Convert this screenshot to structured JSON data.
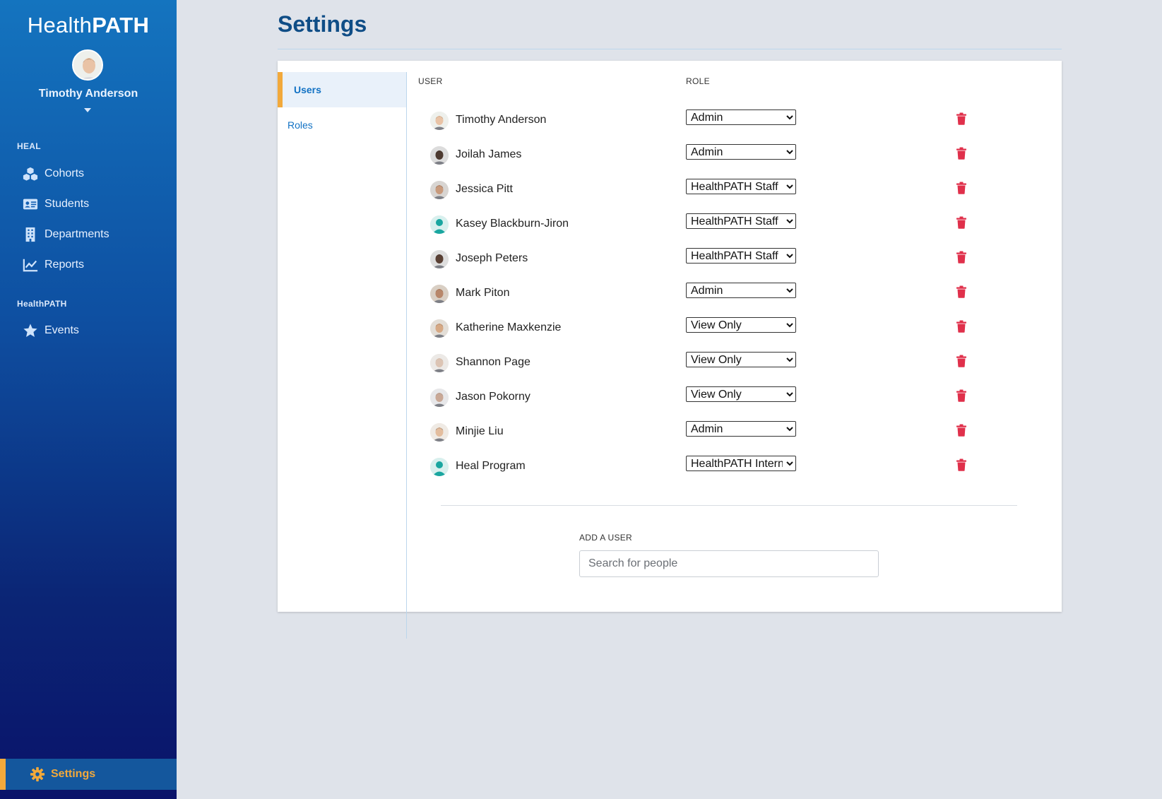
{
  "app": {
    "logo_light": "Health",
    "logo_bold": "PATH"
  },
  "profile": {
    "name": "Timothy Anderson"
  },
  "sidebar": {
    "sections": [
      {
        "title": "HEAL",
        "items": [
          {
            "label": "Cohorts",
            "icon": "cubes-icon"
          },
          {
            "label": "Students",
            "icon": "id-card-icon"
          },
          {
            "label": "Departments",
            "icon": "building-icon"
          },
          {
            "label": "Reports",
            "icon": "chart-line-icon"
          }
        ]
      },
      {
        "title": "HealthPATH",
        "items": [
          {
            "label": "Events",
            "icon": "star-icon"
          }
        ]
      }
    ],
    "settings_label": "Settings",
    "settings_icon": "gear-icon"
  },
  "page": {
    "title": "Settings"
  },
  "tabs": [
    {
      "label": "Users",
      "active": true
    },
    {
      "label": "Roles",
      "active": false
    }
  ],
  "table": {
    "user_header": "USER",
    "role_header": "ROLE",
    "role_options": [
      "Admin",
      "HealthPATH Staff",
      "View Only",
      "HealthPATH Intern"
    ],
    "rows": [
      {
        "name": "Timothy Anderson",
        "role": "Admin"
      },
      {
        "name": "Joilah James",
        "role": "Admin"
      },
      {
        "name": "Jessica Pitt",
        "role": "HealthPATH Staff"
      },
      {
        "name": "Kasey Blackburn-Jiron",
        "role": "HealthPATH Staff"
      },
      {
        "name": "Joseph Peters",
        "role": "HealthPATH Staff"
      },
      {
        "name": "Mark Piton",
        "role": "Admin"
      },
      {
        "name": "Katherine Maxkenzie",
        "role": "View Only"
      },
      {
        "name": "Shannon Page",
        "role": "View Only"
      },
      {
        "name": "Jason Pokorny",
        "role": "View Only"
      },
      {
        "name": "Minjie Liu",
        "role": "Admin"
      },
      {
        "name": "Heal Program",
        "role": "HealthPATH Intern"
      }
    ]
  },
  "add_user": {
    "label": "ADD A USER",
    "placeholder": "Search for people"
  },
  "colors": {
    "accent": "#f2a93b",
    "link": "#1272c4",
    "title": "#0f4d86",
    "danger": "#e0304b"
  }
}
